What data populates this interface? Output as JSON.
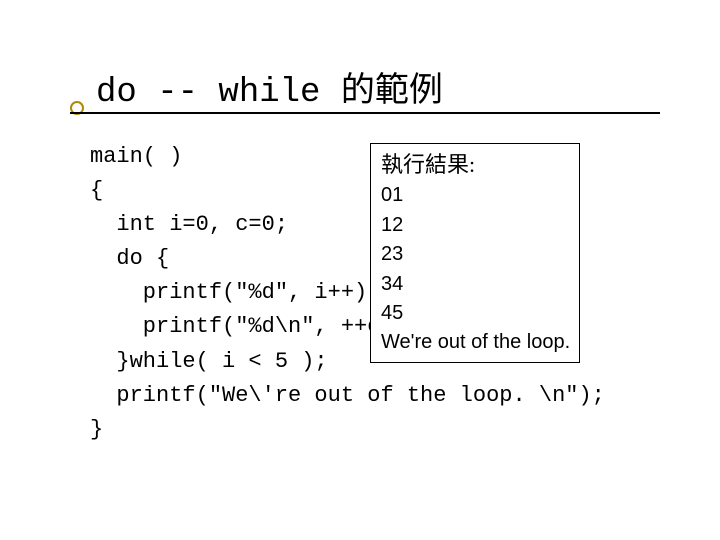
{
  "title": "do -- while 的範例",
  "code": {
    "l1": "main( )",
    "l2": "{",
    "l3": "  int i=0, c=0;",
    "l4": "  do {",
    "l5": "    printf(\"%d\", i++);",
    "l6": "    printf(\"%d\\n\", ++c);",
    "l7": "  }while( i < 5 );",
    "l8": "  printf(\"We\\'re out of the loop. \\n\");",
    "l9": "}"
  },
  "result": {
    "heading": "執行結果:",
    "lines": [
      "01",
      "12",
      "23",
      "34",
      "45"
    ],
    "footer": "We're out of the loop."
  }
}
